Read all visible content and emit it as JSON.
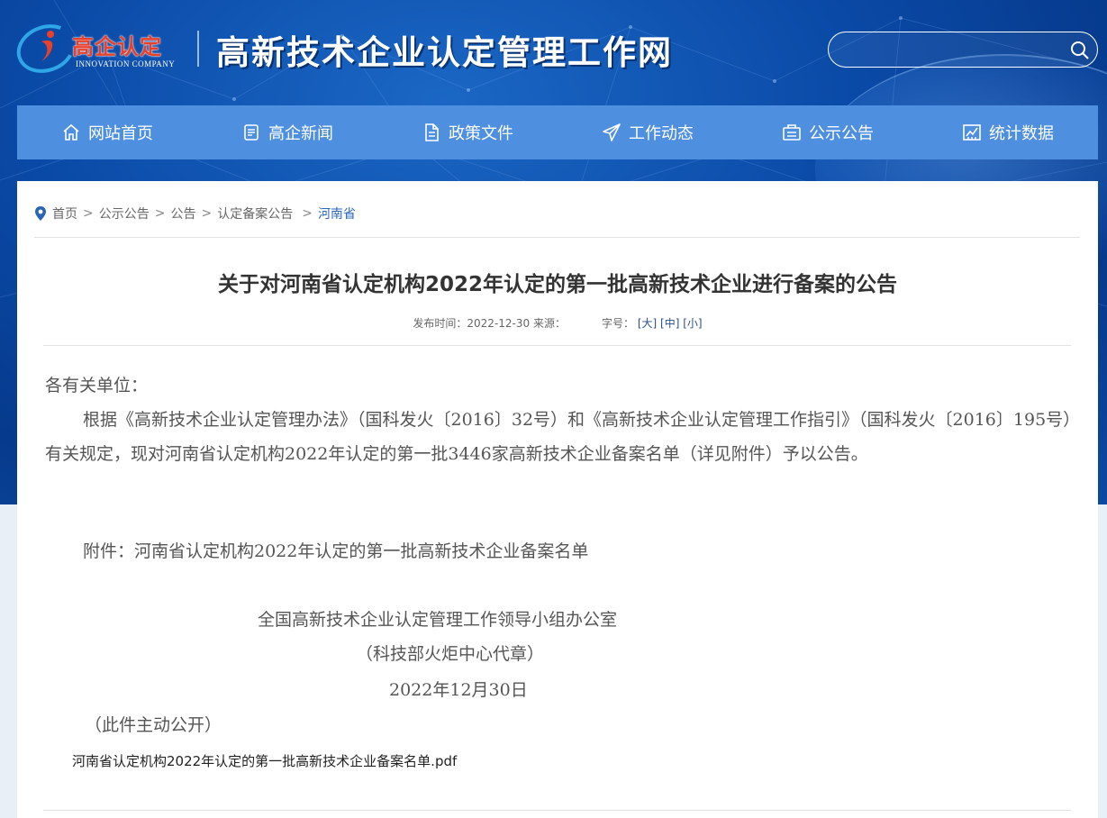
{
  "header": {
    "logo_text": "高企认定",
    "logo_sub": "INNOVATION COMPANY",
    "site_title": "高新技术企业认定管理工作网",
    "search_placeholder": ""
  },
  "nav": [
    {
      "label": "网站首页",
      "icon": "home-icon"
    },
    {
      "label": "高企新闻",
      "icon": "news-icon"
    },
    {
      "label": "政策文件",
      "icon": "document-icon"
    },
    {
      "label": "工作动态",
      "icon": "send-icon"
    },
    {
      "label": "公示公告",
      "icon": "notice-icon"
    },
    {
      "label": "统计数据",
      "icon": "chart-icon"
    }
  ],
  "breadcrumb": {
    "items": [
      "首页",
      "公示公告",
      "公告",
      "认定备案公告"
    ],
    "current": "河南省",
    "separator": ">"
  },
  "article": {
    "title": "关于对河南省认定机构2022年认定的第一批高新技术企业进行备案的公告",
    "meta_publish": "发布时间：2022-12-30 来源：",
    "meta_fontsize_label": "字号：",
    "font_large": "[大]",
    "font_medium": "[中]",
    "font_small": "[小]",
    "salutation": "各有关单位：",
    "paragraph": "根据《高新技术企业认定管理办法》（国科发火〔2016〕32号）和《高新技术企业认定管理工作指引》（国科发火〔2016〕195号）有关规定，现对河南省认定机构2022年认定的第一批3446家高新技术企业备案名单（详见附件）予以公告。",
    "attachment_note": "附件：河南省认定机构2022年认定的第一批高新技术企业备案名单",
    "signature_org": "全国高新技术企业认定管理工作领导小组办公室",
    "signature_seal": "（科技部火炬中心代章）",
    "signature_date": "2022年12月30日",
    "public_note": "（此件主动公开）",
    "file_link": "河南省认定机构2022年认定的第一批高新技术企业备案名单.pdf"
  },
  "colors": {
    "header_bg": "#0a49a6",
    "nav_bg": "#4f8fdf",
    "breadcrumb_current": "#2a66b7",
    "logo_red": "#e8402a",
    "logo_blue": "#2ea6e8"
  }
}
